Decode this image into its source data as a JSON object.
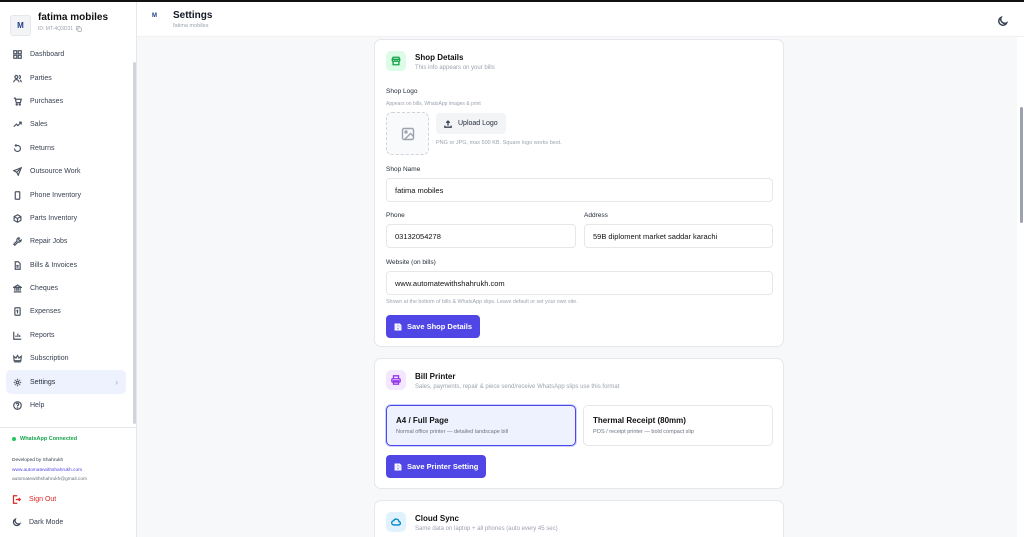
{
  "sidebar": {
    "shop_name": "fatima mobiles",
    "shop_id": "ID: MT-4Q3D31",
    "logo_text": "M",
    "items": [
      {
        "label": "Dashboard",
        "icon": "dashboard-icon"
      },
      {
        "label": "Parties",
        "icon": "users-icon"
      },
      {
        "label": "Purchases",
        "icon": "cart-icon"
      },
      {
        "label": "Sales",
        "icon": "trending-up-icon"
      },
      {
        "label": "Returns",
        "icon": "return-icon"
      },
      {
        "label": "Outsource Work",
        "icon": "send-icon"
      },
      {
        "label": "Phone Inventory",
        "icon": "phone-icon"
      },
      {
        "label": "Parts Inventory",
        "icon": "box-icon"
      },
      {
        "label": "Repair Jobs",
        "icon": "wrench-icon"
      },
      {
        "label": "Bills & Invoices",
        "icon": "file-icon"
      },
      {
        "label": "Cheques",
        "icon": "bank-icon"
      },
      {
        "label": "Expenses",
        "icon": "receipt-icon"
      },
      {
        "label": "Reports",
        "icon": "chart-icon"
      },
      {
        "label": "Subscription",
        "icon": "crown-icon"
      },
      {
        "label": "Settings",
        "icon": "gear-icon"
      },
      {
        "label": "Help",
        "icon": "help-icon"
      }
    ],
    "active_item": "Settings",
    "whatsapp_status": "WhatsApp Connected",
    "developer": {
      "line1": "Developed by Shahrukh",
      "website": "www.automatewithshahrukh.com",
      "email": "automatewithshahrukh@gmail.com"
    },
    "sign_out": "Sign Out",
    "dark_mode": "Dark Mode"
  },
  "header": {
    "title": "Settings",
    "subtitle": "fatima mobiles"
  },
  "shop_details": {
    "title": "Shop Details",
    "subtitle": "This info appears on your bills",
    "logo_label": "Shop Logo",
    "logo_hint": "Appears on bills, WhatsApp images & print",
    "upload_label": "Upload Logo",
    "upload_hint": "PNG or JPG, max 500 KB. Square logo works best.",
    "name_label": "Shop Name",
    "name_value": "fatima mobiles",
    "phone_label": "Phone",
    "phone_value": "03132054278",
    "address_label": "Address",
    "address_value": "59B diploment market saddar karachi",
    "website_label": "Website (on bills)",
    "website_value": "www.automatewithshahrukh.com",
    "website_hint": "Shown at the bottom of bills & WhatsApp slips. Leave default or set your own site.",
    "save_label": "Save Shop Details"
  },
  "bill_printer": {
    "title": "Bill Printer",
    "subtitle": "Sales, payments, repair & piece send/receive WhatsApp slips use this format",
    "options": [
      {
        "title": "A4 / Full Page",
        "desc": "Normal office printer — detailed landscape bill",
        "selected": true
      },
      {
        "title": "Thermal Receipt (80mm)",
        "desc": "POS / receipt printer — bold compact slip",
        "selected": false
      }
    ],
    "save_label": "Save Printer Setting"
  },
  "cloud_sync": {
    "title": "Cloud Sync",
    "subtitle": "Same data on laptop + all phones (auto every 45 sec)"
  },
  "colors": {
    "accent": "#4f46e5",
    "active_bg": "#eef2ff",
    "whatsapp": "#16a34a",
    "danger": "#dc2626"
  }
}
